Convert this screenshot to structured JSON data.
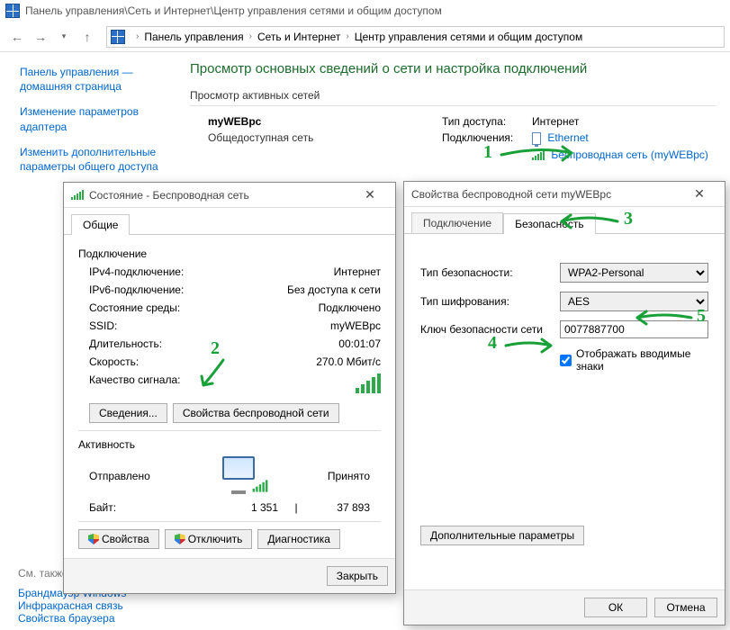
{
  "cp": {
    "title_path": "Панель управления\\Сеть и Интернет\\Центр управления сетями и общим доступом",
    "crumbs": [
      "Панель управления",
      "Сеть и Интернет",
      "Центр управления сетями и общим доступом"
    ],
    "sidebar": {
      "home": "Панель управления — домашняя страница",
      "adapter": "Изменение параметров адаптера",
      "sharing": "Изменить дополнительные параметры общего доступа"
    },
    "h1": "Просмотр основных сведений о сети и настройка подключений",
    "active_hdr": "Просмотр активных сетей",
    "net": {
      "name": "myWEBpc",
      "type": "Общедоступная сеть",
      "access_lbl": "Тип доступа:",
      "access_val": "Интернет",
      "conn_lbl": "Подключения:",
      "eth": "Ethernet",
      "wifi": "Беспроводная сеть (myWEBpc)"
    },
    "seealso": {
      "hdr": "См. также",
      "firewall": "Брандмауэр Windows",
      "ir": "Инфракрасная связь",
      "browser": "Свойства браузера"
    }
  },
  "status": {
    "title": "Состояние - Беспроводная сеть",
    "tab_general": "Общие",
    "sec_conn": "Подключение",
    "ipv4_k": "IPv4-подключение:",
    "ipv4_v": "Интернет",
    "ipv6_k": "IPv6-подключение:",
    "ipv6_v": "Без доступа к сети",
    "media_k": "Состояние среды:",
    "media_v": "Подключено",
    "ssid_k": "SSID:",
    "ssid_v": "myWEBpc",
    "dur_k": "Длительность:",
    "dur_v": "00:01:07",
    "speed_k": "Скорость:",
    "speed_v": "270.0 Мбит/с",
    "sig_k": "Качество сигнала:",
    "btn_details": "Сведения...",
    "btn_wprops": "Свойства беспроводной сети",
    "sec_act": "Активность",
    "sent_lbl": "Отправлено",
    "recv_lbl": "Принято",
    "bytes_lbl": "Байт:",
    "bytes_sent": "1 351",
    "bytes_recv": "37 893",
    "btn_props": "Свойства",
    "btn_disable": "Отключить",
    "btn_diag": "Диагностика",
    "btn_close": "Закрыть"
  },
  "props": {
    "title": "Свойства беспроводной сети myWEBpc",
    "tab_conn": "Подключение",
    "tab_sec": "Безопасность",
    "sectype_k": "Тип безопасности:",
    "sectype_v": "WPA2-Personal",
    "enc_k": "Тип шифрования:",
    "enc_v": "AES",
    "key_k": "Ключ безопасности сети",
    "key_v": "0077887700",
    "show_chars": "Отображать вводимые знаки",
    "btn_adv": "Дополнительные параметры",
    "btn_ok": "ОК",
    "btn_cancel": "Отмена"
  },
  "anno": {
    "n1": "1",
    "n2": "2",
    "n3": "3",
    "n4": "4",
    "n5": "5"
  }
}
